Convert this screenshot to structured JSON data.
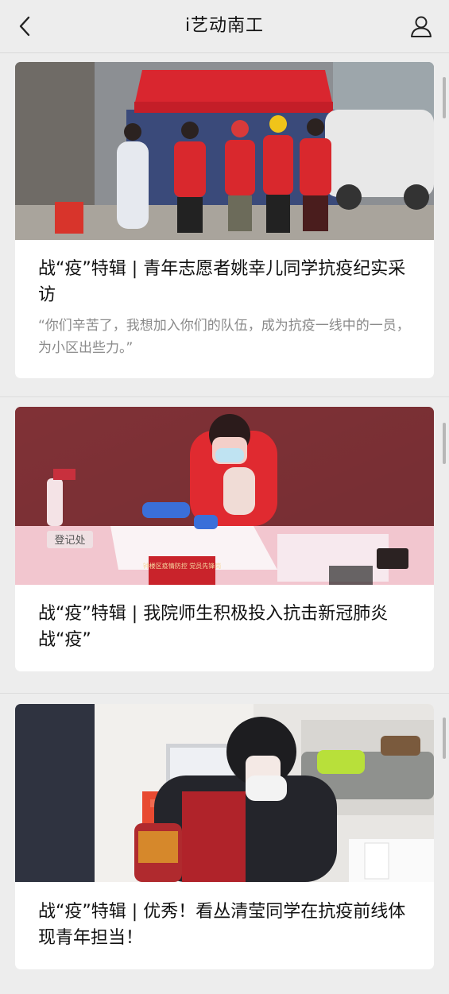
{
  "header": {
    "title": "i艺动南工",
    "back_icon": "chevron-left-icon",
    "profile_icon": "user-icon"
  },
  "articles": [
    {
      "title": "战“疫”特辑 | 青年志愿者姚幸儿同学抗疫纪实采访",
      "digest": "“你们辛苦了，我想加入你们的队伍，成为抗疫一线中的一员，为小区出些力。”",
      "image": "volunteers-red-vests-under-red-tent"
    },
    {
      "title": "战“疫”特辑 | 我院师生积极投入抗击新冠肺炎战“疫”",
      "digest": "",
      "image": "registration-desk-volunteer-red-light",
      "sign_text": "登记处",
      "plate_text": "钟楼区疫情防控 党员先锋岗"
    },
    {
      "title": "战“疫”特辑 | 优秀！看丛清莹同学在抗疫前线体现青年担当！",
      "digest": "",
      "image": "student-red-jacket-writing"
    }
  ]
}
